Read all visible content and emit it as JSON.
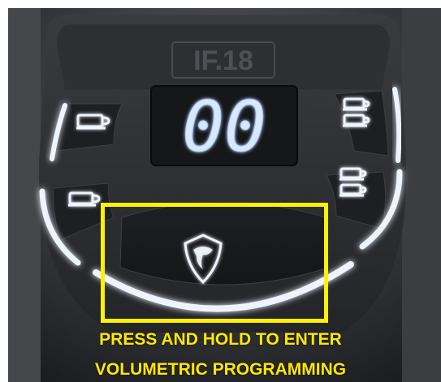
{
  "brand": "IF.18",
  "display": {
    "value": "00"
  },
  "buttons": {
    "one_small_cup": {
      "icon": "one-cup-icon"
    },
    "two_small_cups": {
      "icon": "two-cups-icon"
    },
    "one_large_cup": {
      "icon": "one-cup-icon"
    },
    "two_large_cups": {
      "icon": "two-cups-icon"
    },
    "programming": {
      "icon": "shield-logo-icon"
    }
  },
  "caption": {
    "line1": "PRESS AND HOLD TO ENTER",
    "line2": "VOLUMETRIC PROGRAMMING"
  },
  "colors": {
    "panel": "#2a2b2e",
    "panel_dark": "#141517",
    "led": "#e8eef5",
    "digit_glow": "#9ec8ff",
    "highlight": "#FFF200",
    "caption": "#FFE700"
  }
}
